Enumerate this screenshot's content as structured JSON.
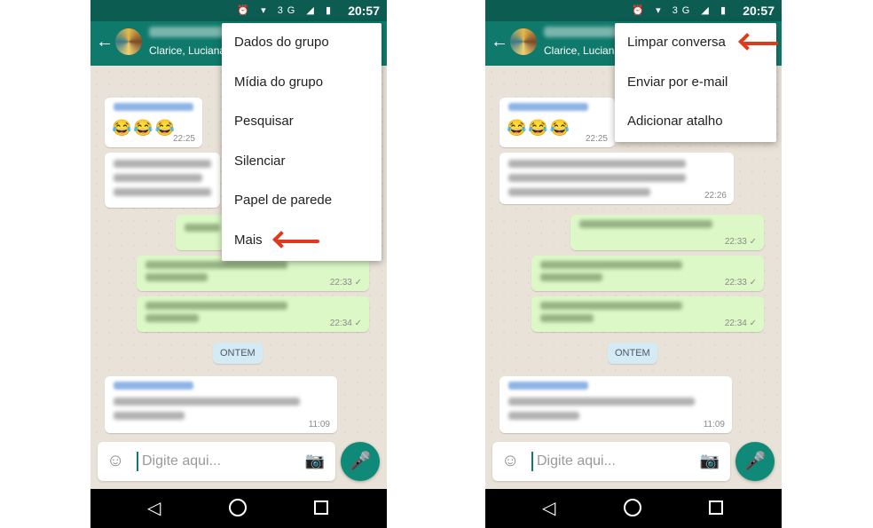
{
  "status_bar": {
    "time": "20:57",
    "network": "3G"
  },
  "chat_header": {
    "members": "Clarice, Luciana,"
  },
  "left_menu": [
    "Dados do grupo",
    "Mídia do grupo",
    "Pesquisar",
    "Silenciar",
    "Papel de parede",
    "Mais"
  ],
  "right_menu": [
    "Limpar conversa",
    "Enviar por e-mail",
    "Adicionar atalho"
  ],
  "messages": {
    "emojis": "😂😂😂",
    "t1": "22:25",
    "t2": "22:26",
    "t3": "22:33 ✓",
    "t4": "22:33 ✓",
    "t5": "22:34 ✓",
    "t6": "11:09"
  },
  "date_divider": "ONTEM",
  "input": {
    "placeholder": "Digite aqui..."
  },
  "colors": {
    "header": "#0f7a6b",
    "status_bar": "#0c5c52",
    "outgoing": "#dcf8c6",
    "arrow": "#e03a1e"
  }
}
